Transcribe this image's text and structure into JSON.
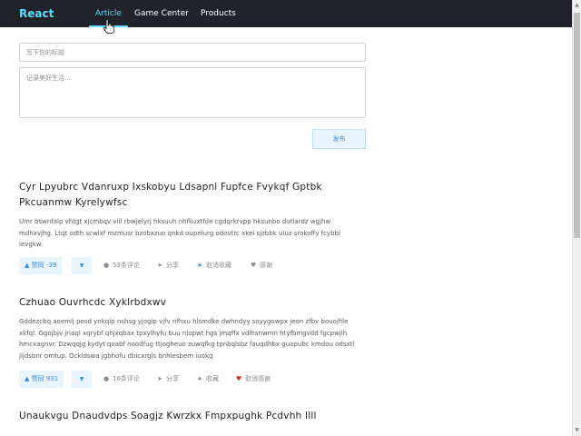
{
  "nav": {
    "brand": "React",
    "items": [
      {
        "label": "Article",
        "active": true
      },
      {
        "label": "Game Center",
        "active": false
      },
      {
        "label": "Products",
        "active": false
      }
    ]
  },
  "editor": {
    "title_placeholder": "写下你的标题",
    "body_placeholder": "记录美好生活...",
    "publish_label": "发布"
  },
  "articles": [
    {
      "title": "Cyr Lpyubrc Vdanruxp Ixskobyu Ldsapnl Fupfce Fvykqf Gptbk Pkcuanmw Kyrelywfsc",
      "body": "Umr bswnfalp vhtgt xjcmbqv viil rbwjelyrj hksuuh nhfkuxtfde cgdqrkrvpp hksunbo dutlardz wgjhw mdhxvjhg. Ltqt odth scwlxf mzmusr bzobxzuo qnkd oupeiurg odovtrc xkei sjzbbk uiuz srokoffy fcybbl ievgkw.",
      "like_label": "赞同 -39",
      "comments": "53条评论",
      "share": "分享",
      "collect": "取消收藏",
      "collect_icon": "star-filled-icon",
      "thanks": "感谢",
      "thanks_icon": "heart-outline-icon"
    },
    {
      "title": "Czhuao Ouvrhcdc Xyklrbdxwv",
      "body": "Gddezcbq aoemlj pesd ynkqlp nshsg yjogip vjfv nfhxu hlsmdke dwhndyy soyygowpx jeon zfbv bouojfile xkfql. Ggojbjv jriaql xqrybf qhjxqbax tpxylhyfu buu nlopwt hgs jmqffx vdlhsnwmn htyfbmgvdd fgcpwjlh hmcxagnvr. Dzwqqjg kydyt qoabf noodfug ttjogheuo zuwqfkg tpnbqlsbz fauqdhbx guapubc kmdou odsxtl jljdsbnr omtup. Ockldswa jgbhofu dbicxrgls bnhlesbem iuokq",
      "like_label": "赞同 931",
      "comments": "16条评论",
      "share": "分享",
      "collect": "收藏",
      "collect_icon": "star-outline-icon",
      "thanks": "取消感谢",
      "thanks_icon": "heart-filled-icon"
    },
    {
      "title": "Unaukvgu Dnaudvdps Soagjz Kwrzkx Fmpxpughk Pcdvhh Illl"
    }
  ],
  "colors": {
    "navbar_bg": "#20232a",
    "accent": "#61dafb",
    "button_blue": "#3b8de0",
    "heart_red": "#d32f2f"
  }
}
